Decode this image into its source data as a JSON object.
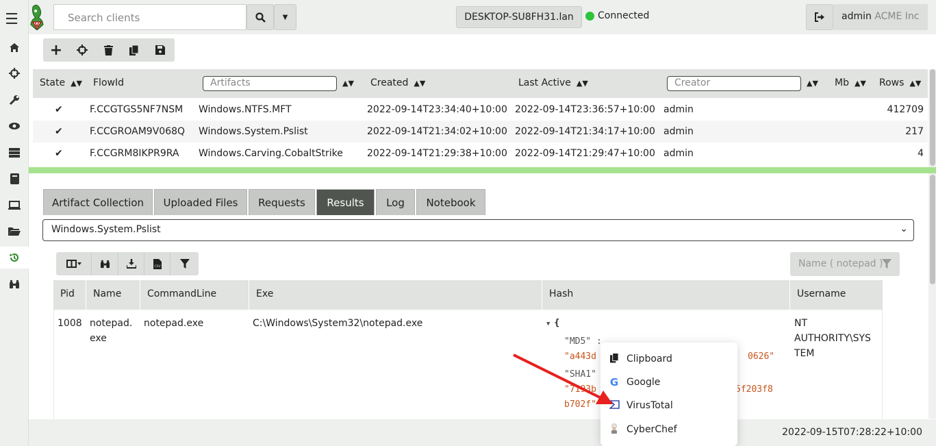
{
  "topbar": {
    "search_placeholder": "Search clients",
    "hostname": "DESKTOP-SU8FH31.lan",
    "status": "Connected",
    "user": "admin",
    "org": "ACME Inc"
  },
  "sidebar": {
    "items": [
      "menu-icon",
      "home-icon",
      "crosshair-icon",
      "wrench-icon",
      "eye-icon",
      "server-icon",
      "book-icon",
      "laptop-icon",
      "folder-icon",
      "history-icon",
      "binoculars-icon"
    ]
  },
  "flows": {
    "columns": {
      "state": "State",
      "flowid": "FlowId",
      "artifacts": "Artifacts",
      "created": "Created",
      "last_active": "Last Active",
      "creator": "Creator",
      "mb": "Mb",
      "rows": "Rows"
    },
    "rows": [
      {
        "state": "✔",
        "flowid": "F.CCGTGS5NF7NSM",
        "artifact": "Windows.NTFS.MFT",
        "created": "2022-09-14T23:34:40+10:00",
        "last_active": "2022-09-14T23:36:57+10:00",
        "creator": "admin",
        "mb": "",
        "rows": "412709"
      },
      {
        "state": "✔",
        "flowid": "F.CCGROAM9V068Q",
        "artifact": "Windows.System.Pslist",
        "created": "2022-09-14T21:34:02+10:00",
        "last_active": "2022-09-14T21:34:17+10:00",
        "creator": "admin",
        "mb": "",
        "rows": "217"
      },
      {
        "state": "✔",
        "flowid": "F.CCGRM8IKPR9RA",
        "artifact": "Windows.Carving.CobaltStrike",
        "created": "2022-09-14T21:29:38+10:00",
        "last_active": "2022-09-14T21:29:47+10:00",
        "creator": "admin",
        "mb": "",
        "rows": "4"
      }
    ]
  },
  "tabs": [
    "Artifact Collection",
    "Uploaded Files",
    "Requests",
    "Results",
    "Log",
    "Notebook"
  ],
  "active_tab": "Results",
  "artifact_select": "Windows.System.Pslist",
  "name_filter": "Name ( notepad )",
  "results": {
    "columns": {
      "pid": "Pid",
      "name": "Name",
      "cmdline": "CommandLine",
      "exe": "Exe",
      "hash": "Hash",
      "username": "Username"
    },
    "row": {
      "pid": "1008",
      "name_line1": "notepad.",
      "name_line2": "exe",
      "cmdline": "notepad.exe",
      "exe": "C:\\Windows\\System32\\notepad.exe",
      "hash_open": "{",
      "md5_key": "\"MD5\" :",
      "md5_val_start": "\"a443d",
      "md5_val_end": "0626\"",
      "sha1_key": "\"SHA1\"",
      "sha1_val_start": "\"7193b",
      "sha1_val_end": "5f203f8",
      "sha1_val_line2": "b702f\"",
      "username_line1": "NT",
      "username_line2": "AUTHORITY\\SYS",
      "username_line3": "TEM"
    }
  },
  "context_menu": {
    "items": [
      {
        "label": "Clipboard",
        "icon": "clipboard-icon"
      },
      {
        "label": "Google",
        "icon": "google-icon"
      },
      {
        "label": "VirusTotal",
        "icon": "virustotal-icon"
      },
      {
        "label": "CyberChef",
        "icon": "cyberchef-icon"
      }
    ]
  },
  "footer": {
    "timestamp": "2022-09-15T07:28:22+10:00"
  },
  "colors": {
    "accent_green": "#a6e38f",
    "connected": "#2ec43b",
    "arrow": "#e8201f"
  }
}
